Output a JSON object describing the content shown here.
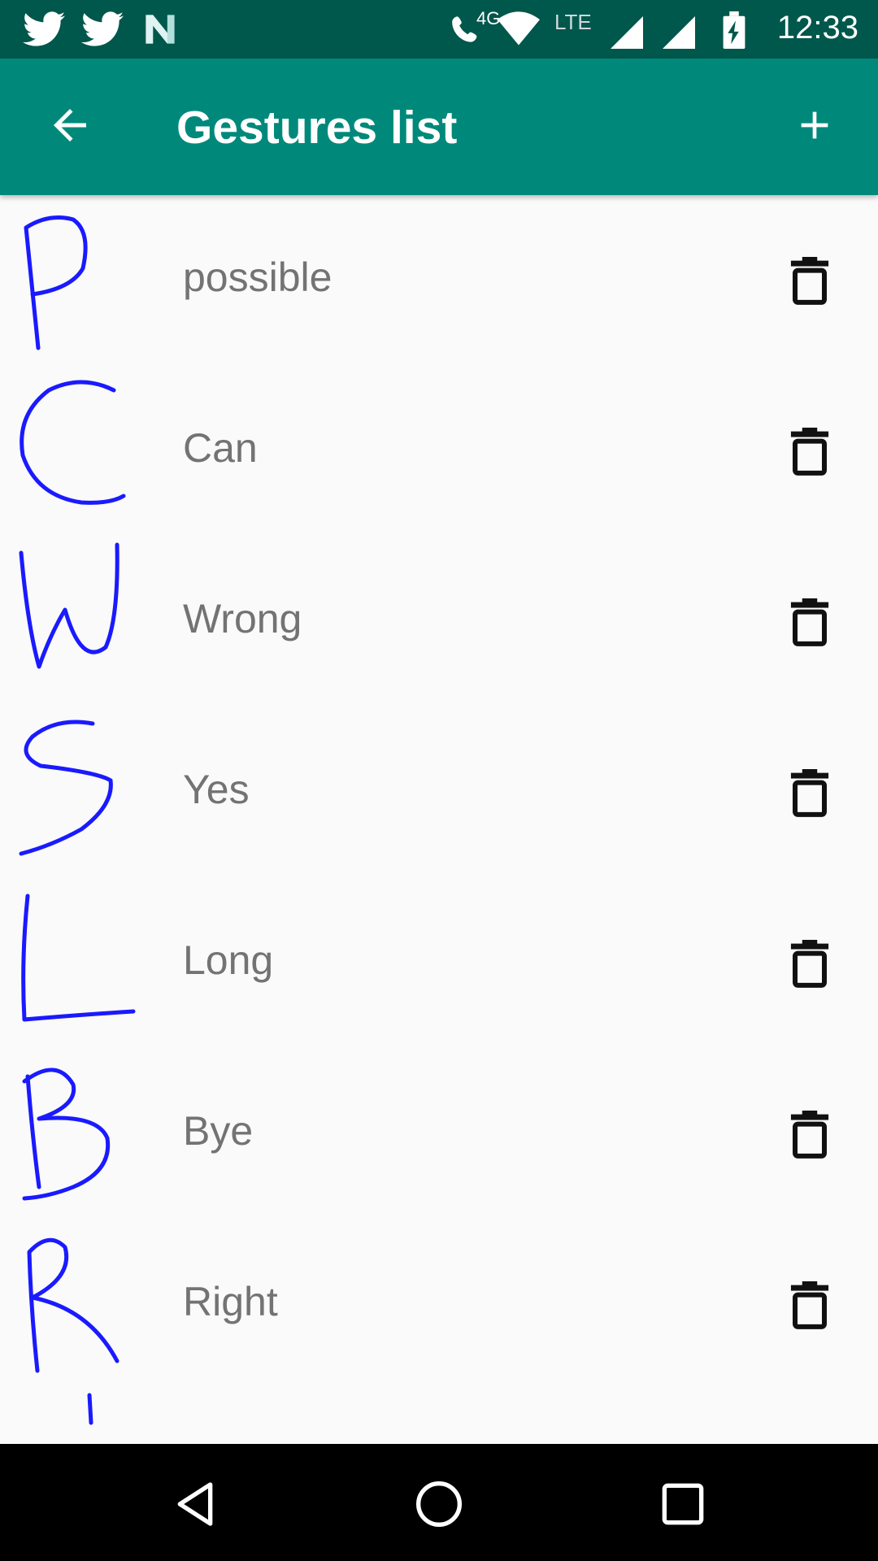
{
  "status_bar": {
    "time": "12:33",
    "network_label": "LTE",
    "call_label": "4G",
    "icons": [
      "twitter-icon",
      "twitter-icon",
      "notification-n-icon",
      "wifi-calling-icon",
      "wifi-icon",
      "signal-icon",
      "signal-icon",
      "battery-charging-icon"
    ]
  },
  "app_bar": {
    "title": "Gestures list",
    "back_icon": "arrow-back-icon",
    "add_icon": "plus-icon"
  },
  "gestures": [
    {
      "label": "possible",
      "letter": "P"
    },
    {
      "label": "Can",
      "letter": "C"
    },
    {
      "label": "Wrong",
      "letter": "W"
    },
    {
      "label": "Yes",
      "letter": "S"
    },
    {
      "label": "Long",
      "letter": "L"
    },
    {
      "label": "Bye",
      "letter": "B"
    },
    {
      "label": "Right",
      "letter": "R"
    }
  ],
  "colors": {
    "status_bar": "#00574b",
    "app_bar": "#00897b",
    "gesture_stroke": "#1a1aff",
    "label_text": "#737373"
  },
  "nav_bar": {
    "icons": [
      "back-triangle-icon",
      "home-circle-icon",
      "recents-square-icon"
    ]
  }
}
